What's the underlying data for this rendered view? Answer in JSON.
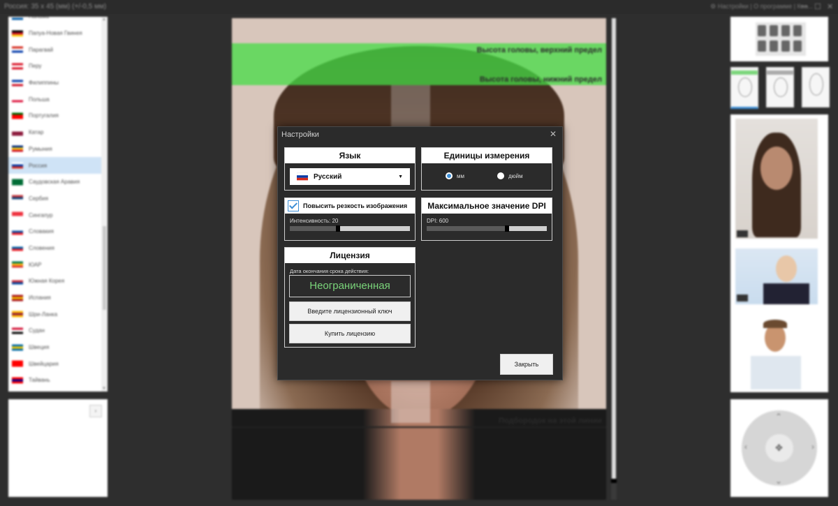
{
  "window": {
    "title": "Россия: 35 x 45 (мм) (+/-0,5 мм)",
    "right_items": "⚙ Настройки | О программе | Ква...",
    "controls": [
      "—",
      "☐",
      "✕"
    ]
  },
  "countries": [
    {
      "name": "Панама",
      "colors": [
        "#d21034",
        "#ffffff",
        "#005aa7"
      ]
    },
    {
      "name": "Папуа-Новая Гвинея",
      "colors": [
        "#000000",
        "#ce1126",
        "#fcd116"
      ]
    },
    {
      "name": "Парагвай",
      "colors": [
        "#d52b1e",
        "#ffffff",
        "#0038a8"
      ]
    },
    {
      "name": "Перу",
      "colors": [
        "#d91023",
        "#ffffff",
        "#d91023"
      ]
    },
    {
      "name": "Филиппины",
      "colors": [
        "#0038a8",
        "#ffffff",
        "#ce1126"
      ]
    },
    {
      "name": "Польша",
      "colors": [
        "#ffffff",
        "#ffffff",
        "#dc143c"
      ]
    },
    {
      "name": "Португалия",
      "colors": [
        "#006600",
        "#ff0000",
        "#ff0000"
      ]
    },
    {
      "name": "Катар",
      "colors": [
        "#ffffff",
        "#8d1b3d",
        "#8d1b3d"
      ]
    },
    {
      "name": "Румыния",
      "colors": [
        "#002b7f",
        "#fcd116",
        "#ce1126"
      ]
    },
    {
      "name": "Россия",
      "colors": [
        "#ffffff",
        "#0039a6",
        "#d52b1e"
      ],
      "selected": true
    },
    {
      "name": "Саудовская Аравия",
      "colors": [
        "#006c35",
        "#006c35",
        "#006c35"
      ]
    },
    {
      "name": "Сербия",
      "colors": [
        "#c6363c",
        "#0c4076",
        "#ffffff"
      ]
    },
    {
      "name": "Сингапур",
      "colors": [
        "#ef3340",
        "#ef3340",
        "#ffffff"
      ]
    },
    {
      "name": "Словакия",
      "colors": [
        "#ffffff",
        "#0b4ea2",
        "#ee1c25"
      ]
    },
    {
      "name": "Словения",
      "colors": [
        "#ffffff",
        "#005da4",
        "#ed1c24"
      ]
    },
    {
      "name": "ЮАР",
      "colors": [
        "#007a4d",
        "#ffb612",
        "#de3831"
      ]
    },
    {
      "name": "Южная Корея",
      "colors": [
        "#ffffff",
        "#cd2e3a",
        "#0047a0"
      ]
    },
    {
      "name": "Испания",
      "colors": [
        "#aa151b",
        "#f1bf00",
        "#aa151b"
      ]
    },
    {
      "name": "Шри-Ланка",
      "colors": [
        "#ffb700",
        "#8d153a",
        "#ffb700"
      ]
    },
    {
      "name": "Судан",
      "colors": [
        "#d21034",
        "#ffffff",
        "#000000"
      ]
    },
    {
      "name": "Швеция",
      "colors": [
        "#006aa7",
        "#fecc00",
        "#006aa7"
      ]
    },
    {
      "name": "Швейцария",
      "colors": [
        "#ff0000",
        "#ff0000",
        "#ff0000"
      ]
    },
    {
      "name": "Тайвань",
      "colors": [
        "#fe0000",
        "#000095",
        "#fe0000"
      ]
    }
  ],
  "photo": {
    "head_top_label": "Высота головы, верхний предел",
    "head_bottom_label": "Высота головы, нижний предел",
    "chin_label": "Подбородок на этой линии"
  },
  "dialog": {
    "title": "Настройки",
    "close": "✕",
    "language": {
      "header": "Язык",
      "selected": "Русский"
    },
    "units": {
      "header": "Единицы измерения",
      "options": [
        {
          "label": "мм",
          "selected": true
        },
        {
          "label": "дюйм",
          "selected": false
        }
      ]
    },
    "sharpen": {
      "label": "Повысить резкость изображения",
      "checked": true,
      "intensity_label": "Интенсивность: 20",
      "intensity_fraction": 0.4
    },
    "dpi": {
      "header": "Максимальное значение DPI",
      "label": "DPI: 600",
      "fraction": 0.67
    },
    "license": {
      "header": "Лицензия",
      "expiry_label": "Дата окончания срока действия:",
      "expiry_value": "Неограниченная",
      "enter_key": "Введите лицензионный ключ",
      "buy": "Купить лицензию"
    },
    "close_button": "Закрыть"
  },
  "colors": {
    "accent": "#3b8ed6",
    "expiry_text": "#7ad47a",
    "guide_band": "#46dc46"
  }
}
